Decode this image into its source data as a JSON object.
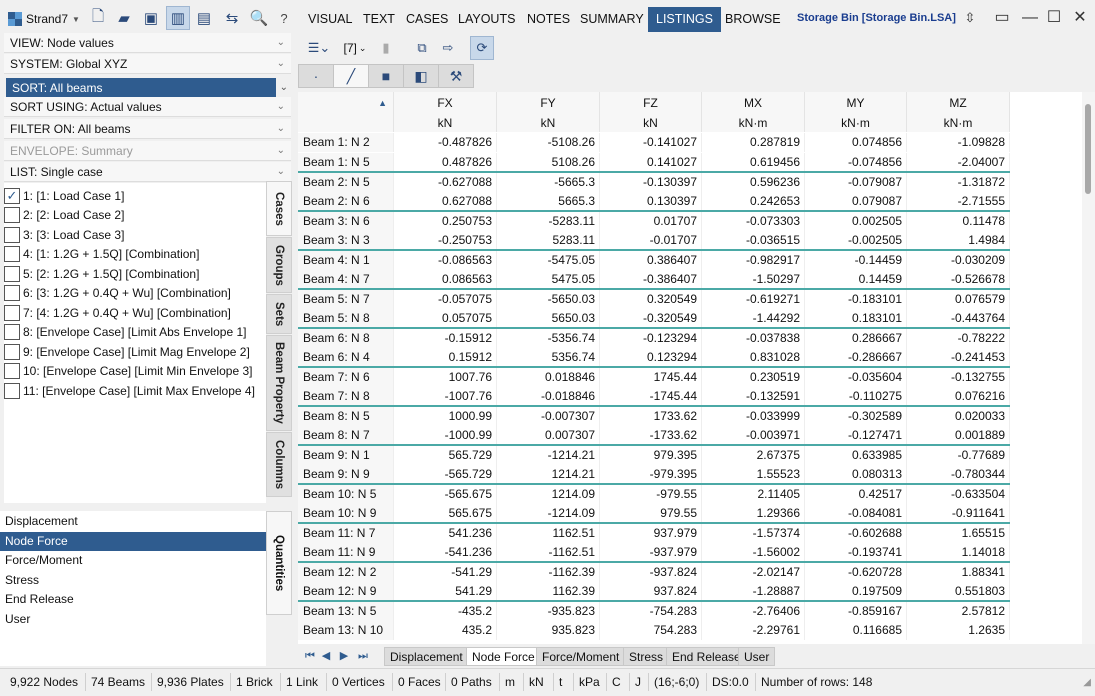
{
  "app": {
    "name": "Strand7"
  },
  "menu": [
    "VISUAL",
    "TEXT",
    "CASES",
    "LAYOUTS",
    "NOTES",
    "SUMMARY",
    "LISTINGS",
    "BROWSE"
  ],
  "active_menu": "LISTINGS",
  "file_title": "Storage Bin [Storage Bin.LSA]",
  "settings": {
    "view": "VIEW: Node values",
    "system": "SYSTEM: Global XYZ",
    "sort": "SORT: All beams",
    "sort_using": "SORT USING: Actual values",
    "filter_on": "FILTER ON: All beams",
    "envelope": "ENVELOPE: Summary",
    "list": "LIST: Single case"
  },
  "cases": [
    {
      "label": "1: [1: Load Case 1]",
      "checked": true
    },
    {
      "label": "2: [2: Load Case 2]",
      "checked": false
    },
    {
      "label": "3: [3: Load Case 3]",
      "checked": false
    },
    {
      "label": "4: [1: 1.2G + 1.5Q] [Combination]",
      "checked": false
    },
    {
      "label": "5: [2: 1.2G + 1.5Q] [Combination]",
      "checked": false
    },
    {
      "label": "6: [3: 1.2G + 0.4Q + Wu] [Combination]",
      "checked": false
    },
    {
      "label": "7: [4: 1.2G + 0.4Q + Wu] [Combination]",
      "checked": false
    },
    {
      "label": "8: [Envelope Case] [Limit Abs Envelope 1]",
      "checked": false
    },
    {
      "label": "9: [Envelope Case] [Limit Mag Envelope 2]",
      "checked": false
    },
    {
      "label": "10: [Envelope Case] [Limit Min Envelope 3]",
      "checked": false
    },
    {
      "label": "11: [Envelope Case] [Limit Max Envelope 4]",
      "checked": false
    }
  ],
  "side_tabs": [
    "Cases",
    "Groups",
    "Sets",
    "Beam Property",
    "Columns"
  ],
  "quantities_tab": "Quantities",
  "quantities": [
    "Displacement",
    "Node Force",
    "Force/Moment",
    "Stress",
    "End Release",
    "User"
  ],
  "selected_quantity": "Node Force",
  "toolbar2": {
    "case_count": "[7]"
  },
  "table": {
    "columns": [
      {
        "name": "FX",
        "unit": "kN"
      },
      {
        "name": "FY",
        "unit": "kN"
      },
      {
        "name": "FZ",
        "unit": "kN"
      },
      {
        "name": "MX",
        "unit": "kN·m"
      },
      {
        "name": "MY",
        "unit": "kN·m"
      },
      {
        "name": "MZ",
        "unit": "kN·m"
      }
    ],
    "rows": [
      {
        "label": "Beam 1: N 2",
        "v": [
          "-0.487826",
          "-5108.26",
          "-0.141027",
          "0.287819",
          "0.074856",
          "-1.09828"
        ]
      },
      {
        "label": "Beam 1: N 5",
        "v": [
          "0.487826",
          "5108.26",
          "0.141027",
          "0.619456",
          "-0.074856",
          "-2.04007"
        ]
      },
      {
        "label": "Beam 2: N 5",
        "v": [
          "-0.627088",
          "-5665.3",
          "-0.130397",
          "0.596236",
          "-0.079087",
          "-1.31872"
        ]
      },
      {
        "label": "Beam 2: N 6",
        "v": [
          "0.627088",
          "5665.3",
          "0.130397",
          "0.242653",
          "0.079087",
          "-2.71555"
        ]
      },
      {
        "label": "Beam 3: N 6",
        "v": [
          "0.250753",
          "-5283.11",
          "0.01707",
          "-0.073303",
          "0.002505",
          "0.11478"
        ]
      },
      {
        "label": "Beam 3: N 3",
        "v": [
          "-0.250753",
          "5283.11",
          "-0.01707",
          "-0.036515",
          "-0.002505",
          "1.4984"
        ]
      },
      {
        "label": "Beam 4: N 1",
        "v": [
          "-0.086563",
          "-5475.05",
          "0.386407",
          "-0.982917",
          "-0.14459",
          "-0.030209"
        ]
      },
      {
        "label": "Beam 4: N 7",
        "v": [
          "0.086563",
          "5475.05",
          "-0.386407",
          "-1.50297",
          "0.14459",
          "-0.526678"
        ]
      },
      {
        "label": "Beam 5: N 7",
        "v": [
          "-0.057075",
          "-5650.03",
          "0.320549",
          "-0.619271",
          "-0.183101",
          "0.076579"
        ]
      },
      {
        "label": "Beam 5: N 8",
        "v": [
          "0.057075",
          "5650.03",
          "-0.320549",
          "-1.44292",
          "0.183101",
          "-0.443764"
        ]
      },
      {
        "label": "Beam 6: N 8",
        "v": [
          "-0.15912",
          "-5356.74",
          "-0.123294",
          "-0.037838",
          "0.286667",
          "-0.78222"
        ]
      },
      {
        "label": "Beam 6: N 4",
        "v": [
          "0.15912",
          "5356.74",
          "0.123294",
          "0.831028",
          "-0.286667",
          "-0.241453"
        ]
      },
      {
        "label": "Beam 7: N 6",
        "v": [
          "1007.76",
          "0.018846",
          "1745.44",
          "0.230519",
          "-0.035604",
          "-0.132755"
        ]
      },
      {
        "label": "Beam 7: N 8",
        "v": [
          "-1007.76",
          "-0.018846",
          "-1745.44",
          "-0.132591",
          "-0.110275",
          "0.076216"
        ]
      },
      {
        "label": "Beam 8: N 5",
        "v": [
          "1000.99",
          "-0.007307",
          "1733.62",
          "-0.033999",
          "-0.302589",
          "0.020033"
        ]
      },
      {
        "label": "Beam 8: N 7",
        "v": [
          "-1000.99",
          "0.007307",
          "-1733.62",
          "-0.003971",
          "-0.127471",
          "0.001889"
        ]
      },
      {
        "label": "Beam 9: N 1",
        "v": [
          "565.729",
          "-1214.21",
          "979.395",
          "2.67375",
          "0.633985",
          "-0.77689"
        ]
      },
      {
        "label": "Beam 9: N 9",
        "v": [
          "-565.729",
          "1214.21",
          "-979.395",
          "1.55523",
          "0.080313",
          "-0.780344"
        ]
      },
      {
        "label": "Beam 10: N 5",
        "v": [
          "-565.675",
          "1214.09",
          "-979.55",
          "2.11405",
          "0.42517",
          "-0.633504"
        ]
      },
      {
        "label": "Beam 10: N 9",
        "v": [
          "565.675",
          "-1214.09",
          "979.55",
          "1.29366",
          "-0.084081",
          "-0.911641"
        ]
      },
      {
        "label": "Beam 11: N 7",
        "v": [
          "541.236",
          "1162.51",
          "937.979",
          "-1.57374",
          "-0.602688",
          "1.65515"
        ]
      },
      {
        "label": "Beam 11: N 9",
        "v": [
          "-541.236",
          "-1162.51",
          "-937.979",
          "-1.56002",
          "-0.193741",
          "1.14018"
        ]
      },
      {
        "label": "Beam 12: N 2",
        "v": [
          "-541.29",
          "-1162.39",
          "-937.824",
          "-2.02147",
          "-0.620728",
          "1.88341"
        ]
      },
      {
        "label": "Beam 12: N 9",
        "v": [
          "541.29",
          "1162.39",
          "937.824",
          "-1.28887",
          "0.197509",
          "0.551803"
        ]
      },
      {
        "label": "Beam 13: N 5",
        "v": [
          "-435.2",
          "-935.823",
          "-754.283",
          "-2.76406",
          "-0.859167",
          "2.57812"
        ]
      },
      {
        "label": "Beam 13: N 10",
        "v": [
          "435.2",
          "935.823",
          "754.283",
          "-2.29761",
          "0.116685",
          "1.2635"
        ]
      }
    ]
  },
  "sheet_tabs": [
    "Displacement",
    "Node Force",
    "Force/Moment",
    "Stress",
    "End Release",
    "User"
  ],
  "active_sheet": "Node Force",
  "status": {
    "nodes": "9,922 Nodes",
    "beams": "74 Beams",
    "plates": "9,936 Plates",
    "bricks": "1 Brick",
    "links": "1 Link",
    "vertices": "0 Vertices",
    "faces": "0 Faces",
    "paths": "0 Paths",
    "u_len": "m",
    "u_force": "kN",
    "u_time": "t",
    "u_stress": "kPa",
    "u_temp": "C",
    "u_energy": "J",
    "coords": "(16;-6;0)",
    "ds": "DS:0.0",
    "rows": "Number of rows: 148"
  }
}
